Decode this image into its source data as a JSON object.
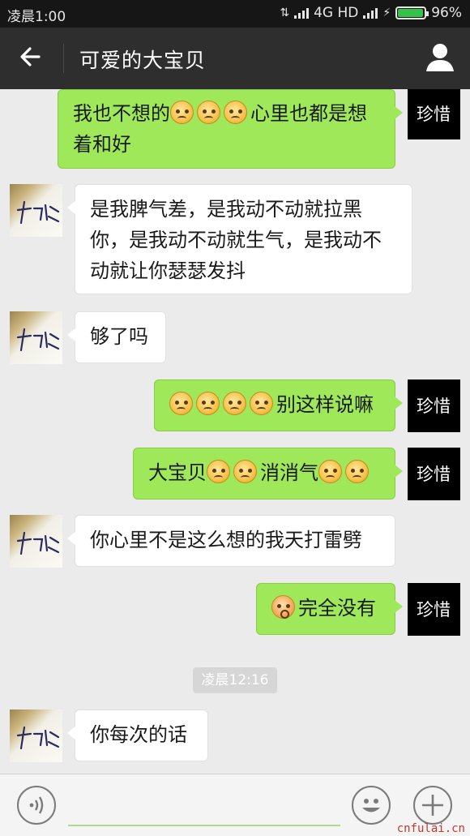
{
  "status_bar": {
    "time": "凌晨1:00",
    "network": "4G HD",
    "battery": "96%",
    "battery_level": 0.96
  },
  "nav": {
    "title": "可爱的大宝贝",
    "back_icon": "arrow-left-icon",
    "profile_icon": "person-icon"
  },
  "messages": [
    {
      "side": "out",
      "segments": [
        {
          "t": "我也不想的"
        },
        {
          "e": "pensive"
        },
        {
          "e": "pensive"
        },
        {
          "e": "pensive"
        },
        {
          "t": "心里也都是想着和好"
        }
      ]
    },
    {
      "side": "in",
      "segments": [
        {
          "t": "是我脾气差，是我动不动就拉黑你，是我动不动就生气，是我动不动就让你瑟瑟发抖"
        }
      ]
    },
    {
      "side": "in",
      "segments": [
        {
          "t": "够了吗"
        }
      ]
    },
    {
      "side": "out",
      "segments": [
        {
          "e": "pensive"
        },
        {
          "e": "pensive"
        },
        {
          "e": "pensive"
        },
        {
          "e": "pensive"
        },
        {
          "t": "别这样说嘛"
        }
      ]
    },
    {
      "side": "out",
      "segments": [
        {
          "t": "大宝贝"
        },
        {
          "e": "pensive"
        },
        {
          "e": "pensive"
        },
        {
          "t": "消消气"
        },
        {
          "e": "pensive"
        },
        {
          "e": "pensive"
        }
      ]
    },
    {
      "side": "in",
      "segments": [
        {
          "t": "你心里不是这么想的我天打雷劈"
        }
      ]
    },
    {
      "side": "out",
      "segments": [
        {
          "e": "surprise"
        },
        {
          "t": "完全没有"
        }
      ]
    },
    {
      "side": "in",
      "segments": [
        {
          "t": "你每次的话"
        }
      ]
    }
  ],
  "timestamp": "凌晨12:16",
  "input_bar": {
    "voice_icon": "voice-icon",
    "emoji_icon": "emoji-icon",
    "plus_icon": "plus-icon"
  },
  "watermark": "cnfulai.cn",
  "avatar_right_text": "珍惜",
  "colors": {
    "outgoing_bubble": "#9fe85a",
    "incoming_bubble": "#ffffff",
    "nav_bar": "#2e2e2e",
    "chat_background": "#ebebeb"
  }
}
